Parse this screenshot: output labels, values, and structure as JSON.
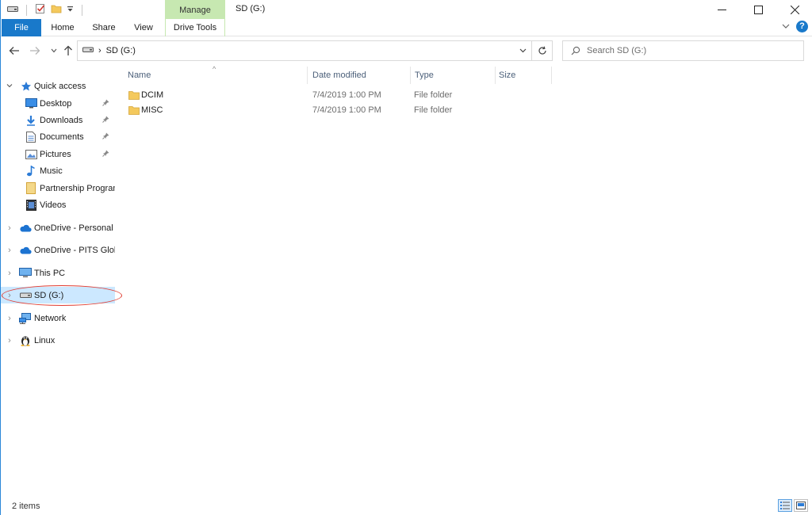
{
  "window": {
    "title": "SD (G:)",
    "context_tab_group": "Manage",
    "controls": {
      "minimize": "—",
      "maximize": "☐",
      "close": "✕"
    }
  },
  "ribbon": {
    "tabs": [
      {
        "label": "File"
      },
      {
        "label": "Home"
      },
      {
        "label": "Share"
      },
      {
        "label": "View"
      },
      {
        "label": "Drive Tools"
      }
    ],
    "collapse_glyph": "⌄",
    "help_glyph": "?"
  },
  "navigation": {
    "back": "←",
    "forward": "→",
    "recent": "⌄",
    "up": "↑",
    "address": {
      "separator": "›",
      "location": "SD (G:)",
      "dropdown": "▾",
      "refresh": "↻"
    },
    "search": {
      "placeholder": "Search SD (G:)"
    }
  },
  "nav_pane": {
    "quick_access": {
      "label": "Quick access",
      "items": [
        {
          "label": "Desktop",
          "pinned": true
        },
        {
          "label": "Downloads",
          "pinned": true
        },
        {
          "label": "Documents",
          "pinned": true
        },
        {
          "label": "Pictures",
          "pinned": true
        },
        {
          "label": "Music",
          "pinned": false
        },
        {
          "label": "Partnership Program",
          "pinned": false
        },
        {
          "label": "Videos",
          "pinned": false
        }
      ]
    },
    "roots": [
      {
        "label": "OneDrive - Personal"
      },
      {
        "label": "OneDrive - PITS Global"
      },
      {
        "label": "This PC"
      },
      {
        "label": "SD (G:)",
        "selected": true
      },
      {
        "label": "Network"
      },
      {
        "label": "Linux"
      }
    ],
    "expand_glyph": "›",
    "pin_glyph": "📌"
  },
  "file_list": {
    "columns": [
      {
        "label": "Name"
      },
      {
        "label": "Date modified"
      },
      {
        "label": "Type"
      },
      {
        "label": "Size"
      }
    ],
    "sort_glyph": "^",
    "rows": [
      {
        "name": "DCIM",
        "date": "7/4/2019 1:00 PM",
        "type": "File folder",
        "size": ""
      },
      {
        "name": "MISC",
        "date": "7/4/2019 1:00 PM",
        "type": "File folder",
        "size": ""
      }
    ]
  },
  "status": {
    "item_count": "2 items"
  },
  "colors": {
    "accent": "#1979ca",
    "manage_tab": "#c7e8b1",
    "selection": "#cce8ff",
    "highlight_oval": "#e03c31",
    "folder": "#f4c95d"
  }
}
